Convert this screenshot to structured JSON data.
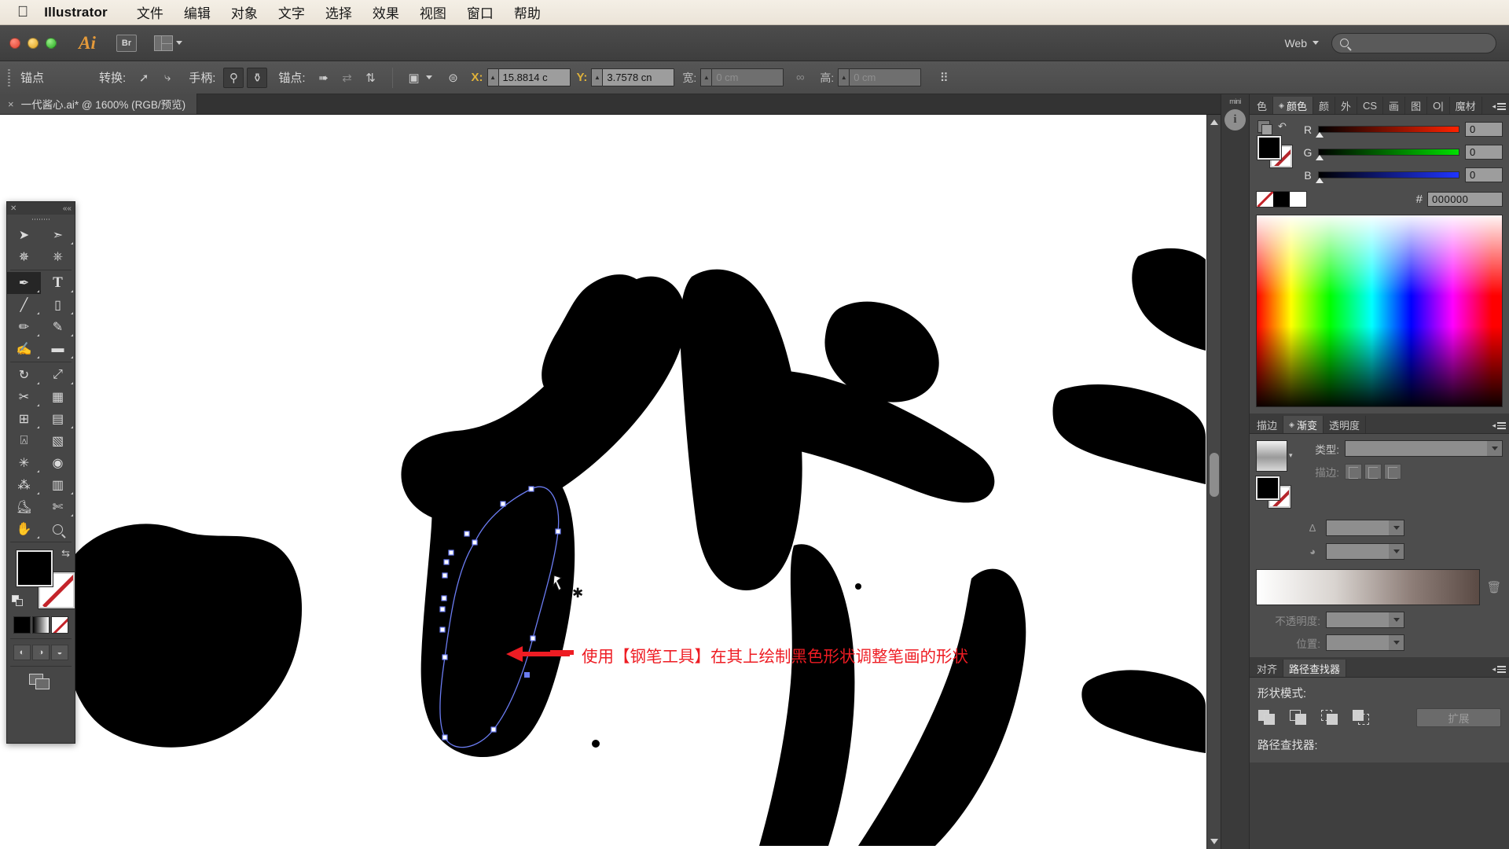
{
  "mac_menu": {
    "apple": "apple-logo",
    "app_name": "Illustrator",
    "items": [
      "文件",
      "编辑",
      "对象",
      "文字",
      "选择",
      "效果",
      "视图",
      "窗口",
      "帮助"
    ]
  },
  "titlebar": {
    "ai_mark": "Ai",
    "bridge_label": "Br",
    "arrange_label": "arrange-documents",
    "workspace": "Web",
    "search_placeholder": "",
    "search_value": ""
  },
  "control_bar": {
    "anchor_label": "锚点",
    "convert_label": "转换:",
    "handle_label": "手柄:",
    "anchor2_label": "锚点:",
    "x_label": "X:",
    "x_value": "15.8814 c",
    "y_label": "Y:",
    "y_value": "3.7578 cn",
    "w_label": "宽:",
    "w_value": "0 cm",
    "link_label": "link-dimensions",
    "h_label": "高:",
    "h_value": "0 cm",
    "transform_label": "transform-each"
  },
  "document_tab": {
    "close": "×",
    "title": "一代酱心.ai* @ 1600% (RGB/预览)"
  },
  "canvas": {
    "annotation": "使用【钢笔工具】在其上绘制黑色形状调整笔画的形状",
    "annotation_color": "#ee1c23",
    "artwork_color": "#000000",
    "background": "#ffffff",
    "path_color": "#5b6ef5"
  },
  "toolbar": {
    "tools": [
      {
        "name": "selection-tool",
        "glyph": "➤",
        "selected": false
      },
      {
        "name": "direct-selection-tool",
        "glyph": "➢",
        "selected": false
      },
      {
        "name": "magic-wand-tool",
        "glyph": "✳",
        "selected": false
      },
      {
        "name": "lasso-tool",
        "glyph": "◠",
        "selected": false
      },
      {
        "name": "pen-tool",
        "glyph": "✒",
        "selected": true
      },
      {
        "name": "type-tool",
        "glyph": "T",
        "selected": false
      },
      {
        "name": "line-segment-tool",
        "glyph": "╱",
        "selected": false
      },
      {
        "name": "rectangle-tool",
        "glyph": "▭",
        "selected": false
      },
      {
        "name": "paintbrush-tool",
        "glyph": "🖌",
        "selected": false
      },
      {
        "name": "pencil-tool",
        "glyph": "✎",
        "selected": false
      },
      {
        "name": "blob-brush-tool",
        "glyph": "✍",
        "selected": false
      },
      {
        "name": "eraser-tool",
        "glyph": "▰",
        "selected": false
      },
      {
        "name": "rotate-tool",
        "glyph": "↻",
        "selected": false
      },
      {
        "name": "scale-tool",
        "glyph": "⤢",
        "selected": false
      },
      {
        "name": "width-tool",
        "glyph": "✂",
        "selected": false
      },
      {
        "name": "free-transform-tool",
        "glyph": "▨",
        "selected": false
      },
      {
        "name": "shape-builder-tool",
        "glyph": "⊞",
        "selected": false
      },
      {
        "name": "perspective-grid-tool",
        "glyph": "▤",
        "selected": false
      },
      {
        "name": "mesh-tool",
        "glyph": "⌗",
        "selected": false
      },
      {
        "name": "gradient-tool",
        "glyph": "▧",
        "selected": false
      },
      {
        "name": "eyedropper-tool",
        "glyph": "⌕",
        "selected": false
      },
      {
        "name": "blend-tool",
        "glyph": "◉",
        "selected": false
      },
      {
        "name": "symbol-sprayer-tool",
        "glyph": "⁂",
        "selected": false
      },
      {
        "name": "column-graph-tool",
        "glyph": "▥",
        "selected": false
      },
      {
        "name": "artboard-tool",
        "glyph": "⌸",
        "selected": false
      },
      {
        "name": "slice-tool",
        "glyph": "✄",
        "selected": false
      },
      {
        "name": "hand-tool",
        "glyph": "✋",
        "selected": false
      },
      {
        "name": "zoom-tool",
        "glyph": "🔍",
        "selected": false
      }
    ],
    "fill_color": "#000000",
    "stroke_color": "none",
    "mini_swatches": [
      "color-black",
      "gradient",
      "none"
    ],
    "draw_modes": [
      "draw-normal",
      "draw-behind",
      "draw-inside"
    ],
    "screen_mode": "screen-mode-toggle"
  },
  "right_dock": {
    "mini_label": "mini",
    "info_icon": "info-icon",
    "color_panel": {
      "tabs": [
        {
          "label": "色",
          "active": false
        },
        {
          "label": "颜色",
          "active": true
        },
        {
          "label": "颜",
          "active": false
        },
        {
          "label": "外",
          "active": false
        },
        {
          "label": "CS",
          "active": false
        },
        {
          "label": "画",
          "active": false
        },
        {
          "label": "图",
          "active": false
        },
        {
          "label": "O|",
          "active": false
        },
        {
          "label": "魔材",
          "active": false
        }
      ],
      "channels": [
        {
          "name": "R",
          "value": "0"
        },
        {
          "name": "G",
          "value": "0"
        },
        {
          "name": "B",
          "value": "0"
        }
      ],
      "hash_label": "#",
      "hex_value": "000000",
      "fill_color": "#000000",
      "stroke_color": "none"
    },
    "gradient_panel": {
      "tabs": [
        {
          "label": "描边",
          "active": false
        },
        {
          "label": "渐变",
          "active": true
        },
        {
          "label": "透明度",
          "active": false
        }
      ],
      "type_label": "类型:",
      "type_value": "",
      "stroke_label": "描边:",
      "angle_label": "",
      "angle_value": "",
      "aspect_label": "",
      "aspect_value": "",
      "opacity_label": "不透明度:",
      "opacity_value": "",
      "position_label": "位置:",
      "position_value": "",
      "delete_icon": "trash-icon"
    },
    "pathfinder_panel": {
      "tabs": [
        {
          "label": "对齐",
          "active": false
        },
        {
          "label": "路径查找器",
          "active": true
        }
      ],
      "shape_modes_label": "形状模式:",
      "shape_modes": [
        "unite",
        "minus-front",
        "intersect",
        "exclude"
      ],
      "expand_label": "扩展",
      "pathfinders_label": "路径查找器:"
    }
  }
}
